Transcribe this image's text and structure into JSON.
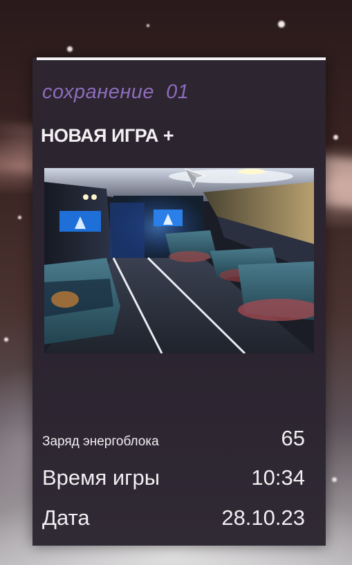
{
  "save_slot": {
    "slot_label": "сохранение  01",
    "mode_title": "НОВАЯ ИГРА +",
    "screenshot_icon": "spaceship-cabin-interior-preview",
    "stats": {
      "energy": {
        "label": "Заряд энергоблока",
        "value": "65"
      },
      "playtime": {
        "label": "Время игры",
        "value": "10:34"
      },
      "date": {
        "label": "Дата",
        "value": "28.10.23"
      }
    }
  },
  "colors": {
    "slot_label": "#8d6cbb",
    "card_bg": "#2d2530",
    "text": "#f1eff1"
  },
  "cursor_icon": "arrow-cursor-icon"
}
